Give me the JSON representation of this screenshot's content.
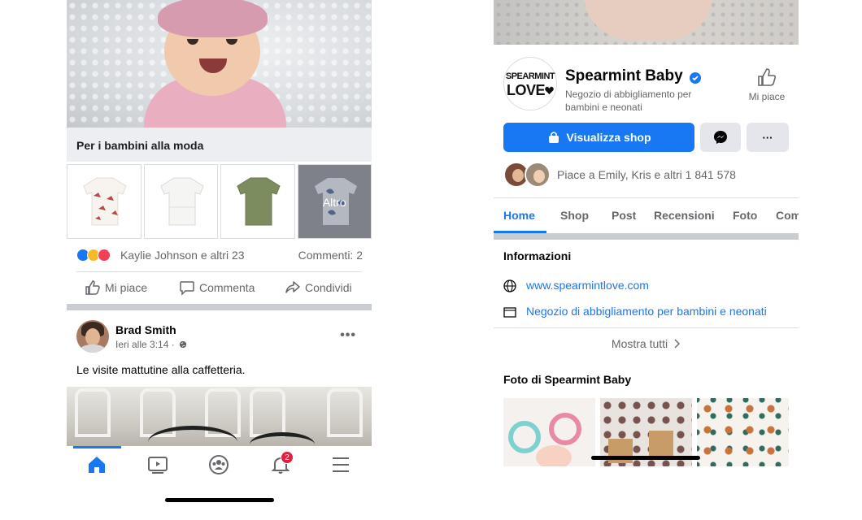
{
  "left": {
    "product_caption": "Per i bambini alla moda",
    "more_label": "Altro",
    "reactions": {
      "names": "Kaylie Johnson e altri 23",
      "comments": "Commenti: 2"
    },
    "actions": {
      "like": "Mi piace",
      "comment": "Commenta",
      "share": "Condividi"
    },
    "post": {
      "author": "Brad Smith",
      "time": "Ieri alle 3:14 ·",
      "text": "Le visite mattutine alla caffetteria."
    },
    "tabbar": {
      "notifications_badge": "2"
    }
  },
  "right": {
    "logo_line1": "SPEARMINT",
    "logo_line2": "LOVE",
    "page_name": "Spearmint Baby",
    "category": "Negozio di abbigliamento per bambini e neonati",
    "like_label": "Mi piace",
    "shop_button": "Visualizza shop",
    "more_button": "···",
    "likers_text": "Piace a Emily, Kris e altri 1 841 578",
    "tabs": [
      "Home",
      "Shop",
      "Post",
      "Recensioni",
      "Foto",
      "Com"
    ],
    "info_title": "Informazioni",
    "website": "www.spearmintlove.com",
    "store_category": "Negozio di abbigliamento per bambini e neonati",
    "see_all": "Mostra tutti",
    "photos_title": "Foto di Spearmint Baby"
  },
  "colors": {
    "accent": "#1877f2",
    "secondary_text": "#65676b",
    "badge": "#e41e3f",
    "divider": "#c9ccd1"
  }
}
